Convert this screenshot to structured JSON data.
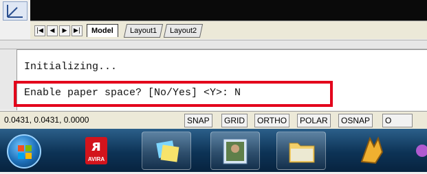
{
  "layout_tabs": {
    "nav_first": "|◀",
    "nav_prev": "◀",
    "nav_next": "▶",
    "nav_last": "▶|",
    "tabs": [
      {
        "label": "Model",
        "active": true
      },
      {
        "label": "Layout1",
        "active": false
      },
      {
        "label": "Layout2",
        "active": false
      }
    ]
  },
  "command_window": {
    "history_line": "Initializing...",
    "prompt_line": "Enable paper space? [No/Yes] <Y>: N",
    "highlight_color": "#e3001b"
  },
  "status_bar": {
    "coordinates": "0.0431, 0.0431, 0.0000",
    "buttons": [
      "SNAP",
      "GRID",
      "ORTHO",
      "POLAR",
      "OSNAP",
      "O"
    ]
  },
  "taskbar": {
    "icons": [
      "windows-start-icon",
      "avira-icon",
      "sticky-notes-icon",
      "photo-viewer-icon",
      "file-explorer-icon",
      "winamp-icon",
      "app-icon"
    ],
    "avira_text": "AVIRA"
  }
}
